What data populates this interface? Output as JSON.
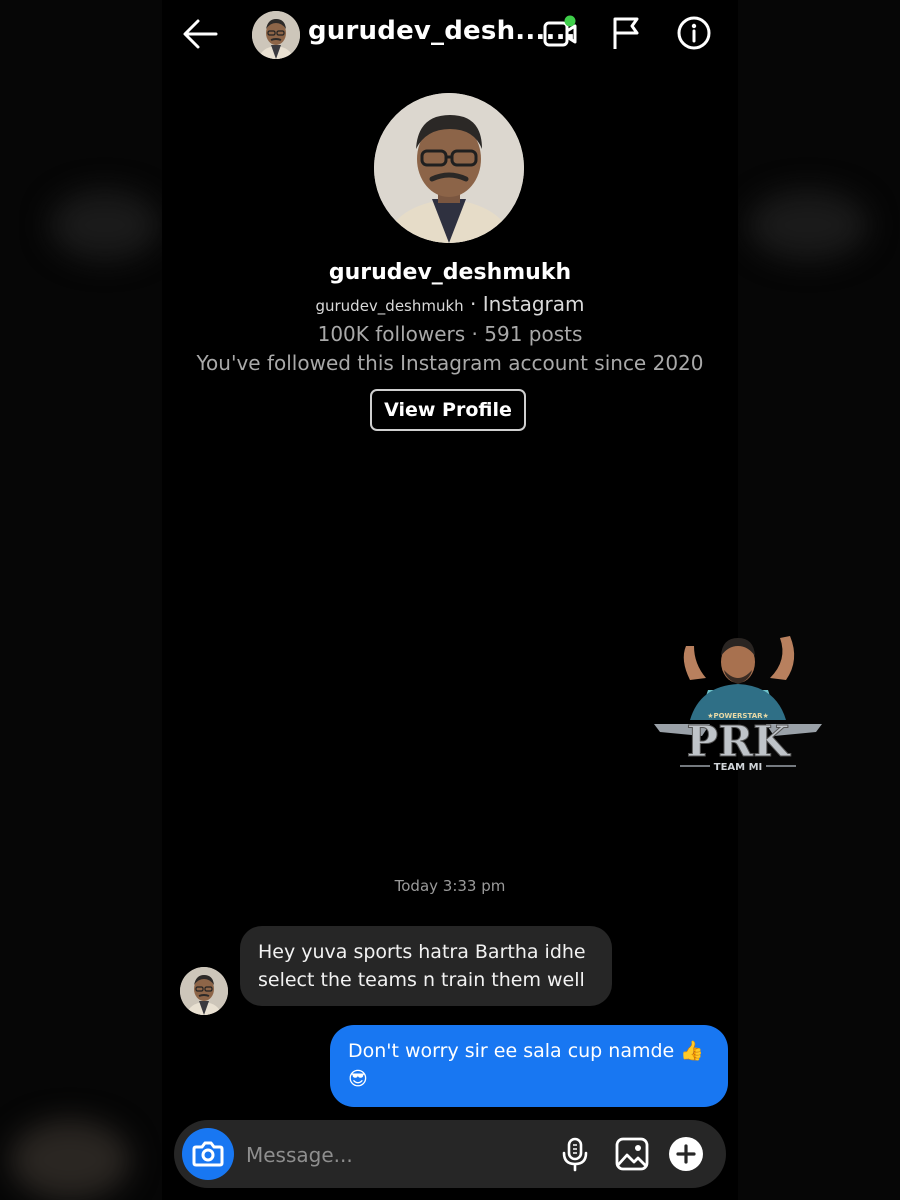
{
  "header": {
    "title": "gurudev_desh......",
    "back_icon": "arrow-left-icon",
    "video_icon": "video-call-icon",
    "flag_icon": "flag-icon",
    "info_icon": "info-icon"
  },
  "profile": {
    "username": "gurudev_deshmukh",
    "handle": "gurudev_deshmukh",
    "platform": "· Instagram",
    "stats": "100K followers · 591 posts",
    "follow_note": "You've followed this Instagram account since 2020",
    "view_profile_label": "View Profile"
  },
  "sticker": {
    "top_text": "★POWERSTAR★",
    "main_text": "PRK",
    "bottom_text": "TEAM MI"
  },
  "chat": {
    "timestamp": "Today 3:33 pm",
    "messages": [
      {
        "direction": "incoming",
        "line1": "Hey yuva sports hatra Bartha idhe",
        "line2": "select the teams n train them well"
      },
      {
        "direction": "outgoing",
        "line1": "Don't worry sir ee sala cup namde 👍",
        "line2": "😎"
      }
    ]
  },
  "composer": {
    "placeholder": "Message...",
    "camera_icon": "camera-icon",
    "mic_icon": "microphone-icon",
    "gallery_icon": "gallery-icon",
    "plus_icon": "plus-circle-icon"
  },
  "colors": {
    "background": "#000000",
    "incoming_bubble": "#262626",
    "outgoing_bubble": "#1877f2",
    "online_dot": "#3ecf4a"
  }
}
